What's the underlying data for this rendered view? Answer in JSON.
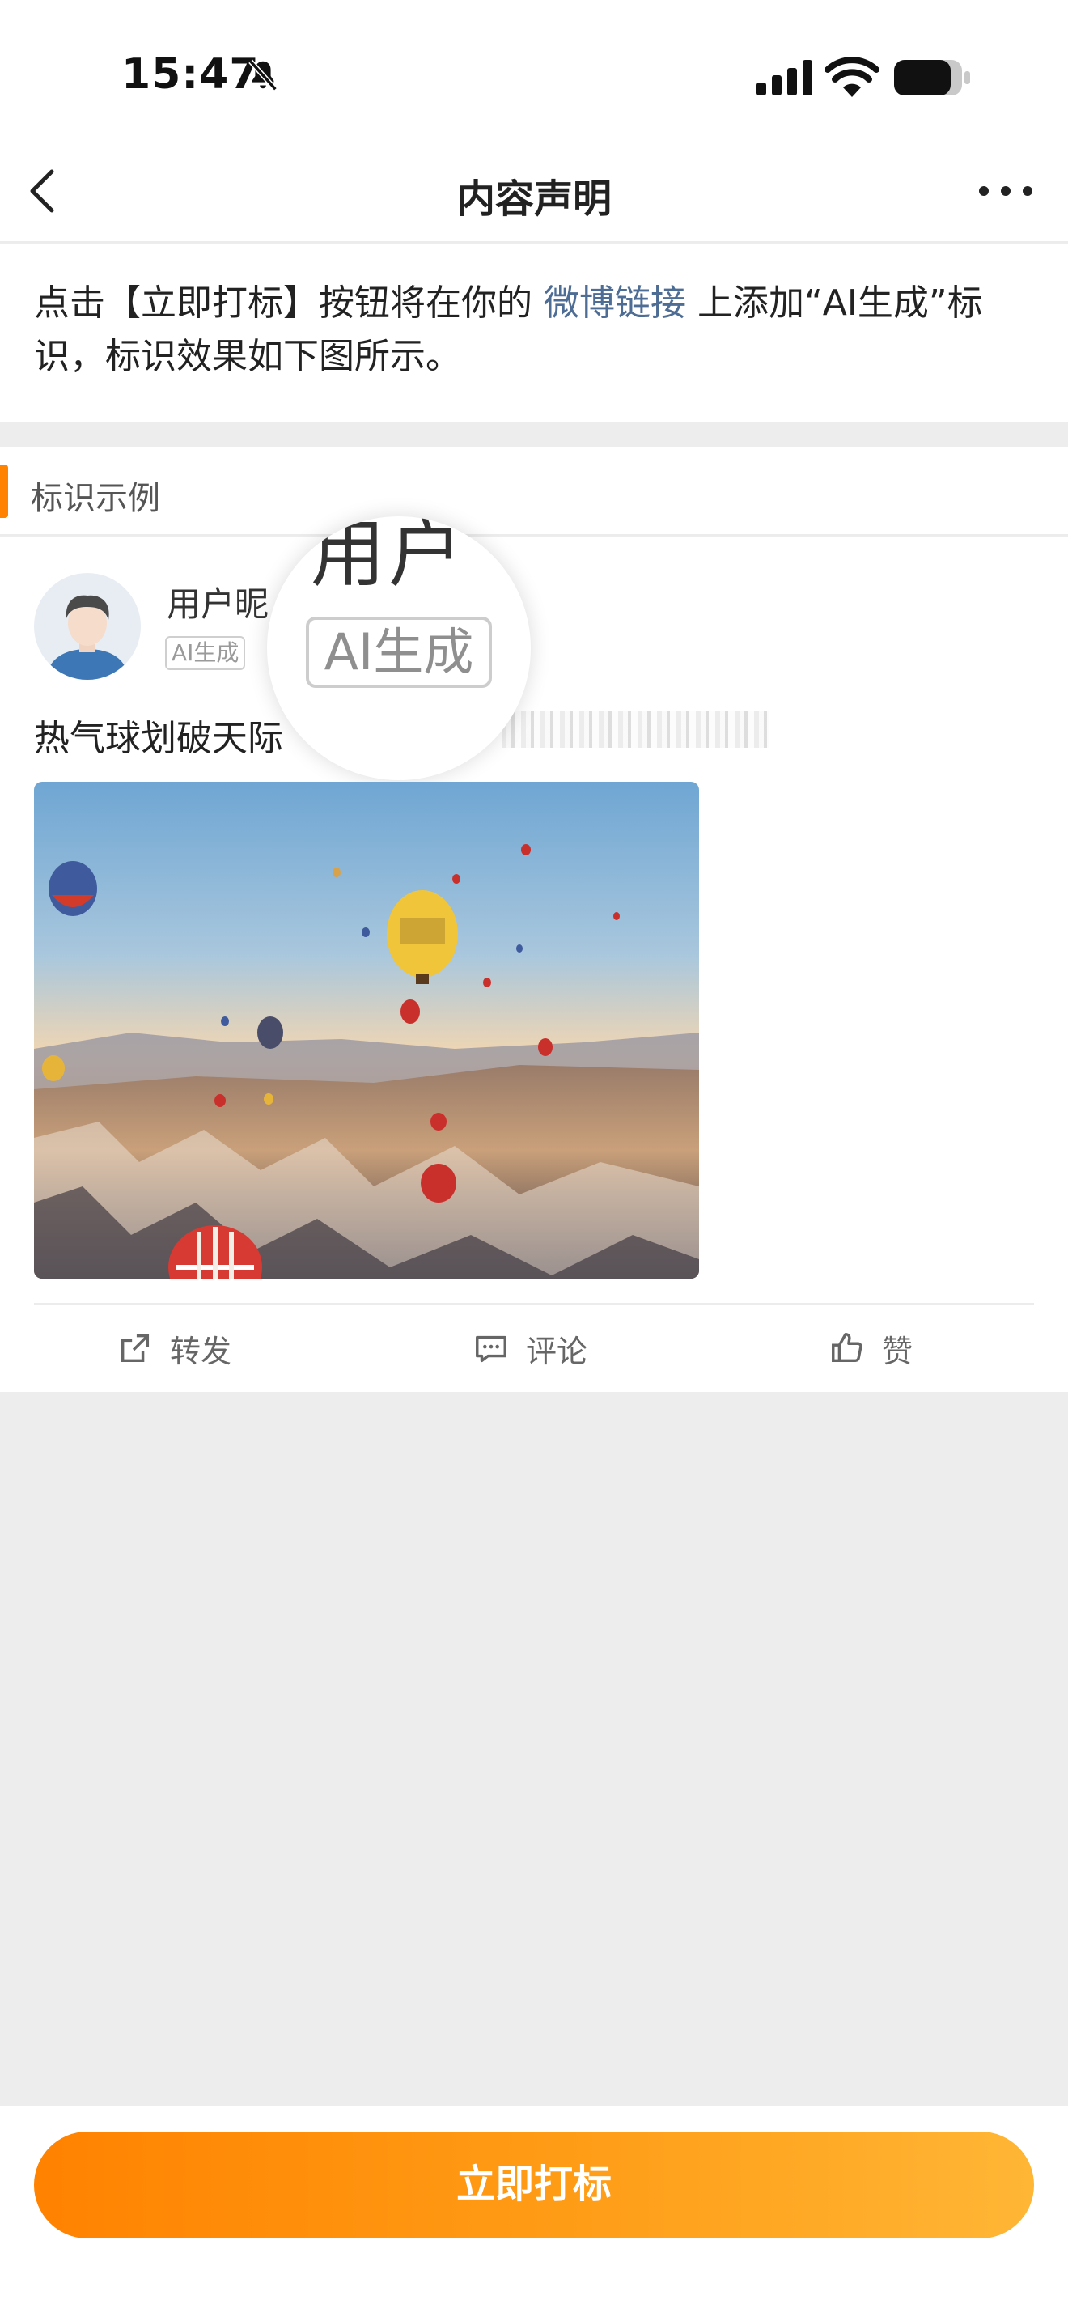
{
  "status_bar": {
    "time": "15:47",
    "icons": [
      "bell-slash-icon",
      "cellular-signal-icon",
      "wifi-icon",
      "battery-icon"
    ]
  },
  "nav": {
    "title": "内容声明",
    "back_icon": "chevron-left-icon",
    "more_icon": "more-horizontal-icon"
  },
  "description": {
    "prefix": "点击【立即打标】按钮将在你的",
    "link": "微博链接",
    "suffix": "上添加“AI生成”标识，标识效果如下图所示。"
  },
  "section": {
    "title": "标识示例"
  },
  "sample_post": {
    "nickname": "用户昵",
    "badge": "AI生成",
    "text": "热气球划破天际",
    "image_alt": "hot-air-balloons-image",
    "magnifier": {
      "partial_text": "用户",
      "badge": "AI生成"
    },
    "actions": {
      "repost": "转发",
      "comment": "评论",
      "like": "赞"
    }
  },
  "cta": {
    "label": "立即打标"
  },
  "colors": {
    "accent": "#ff8200",
    "link": "#4e6d94",
    "background": "#ededed"
  }
}
